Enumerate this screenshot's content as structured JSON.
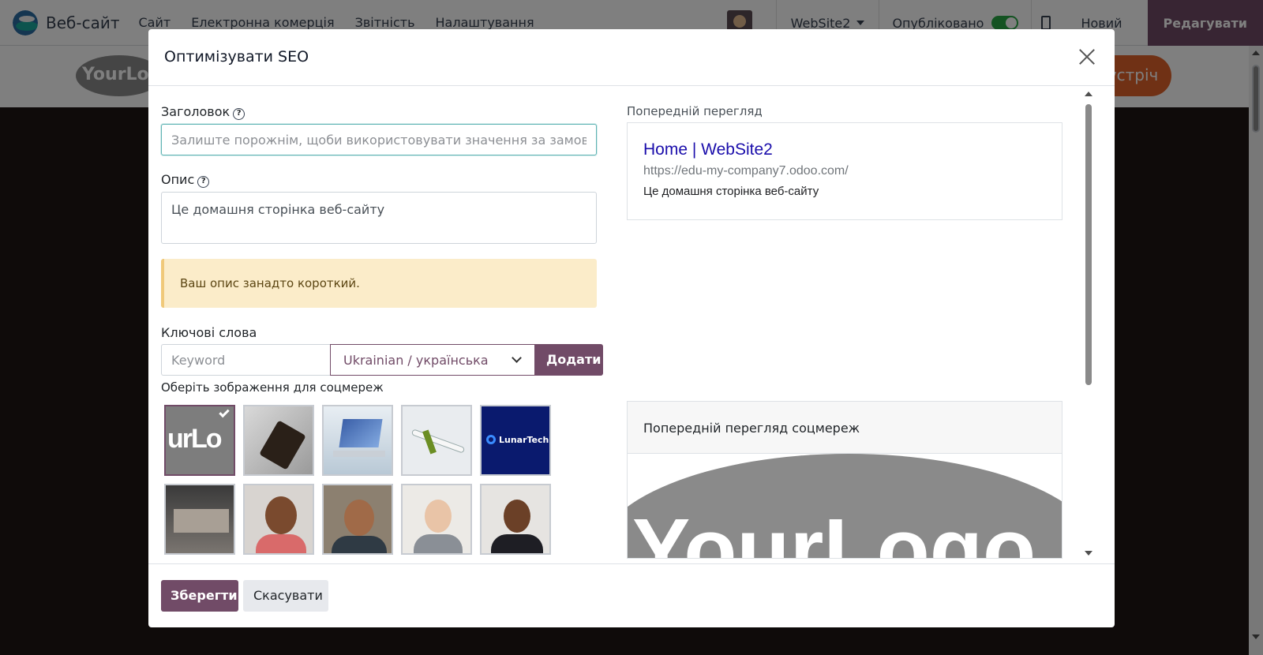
{
  "navbar": {
    "app_title": "Веб-сайт",
    "menu": [
      "Сайт",
      "Електронна комерція",
      "Звітність",
      "Налаштування"
    ],
    "website_switcher": "WebSite2",
    "published_label": "Опубліковано",
    "new_label": "Новий",
    "edit_label": "Редагувати"
  },
  "page": {
    "logo_text": "YourLogo",
    "cta_text": "Зустріч"
  },
  "modal": {
    "title": "Оптимізувати SEO",
    "title_field": {
      "label": "Заголовок",
      "value": "",
      "placeholder": "Залиште порожнім, щоби використовувати значення за замовчуванням"
    },
    "description_field": {
      "label": "Опис",
      "value": "Це домашня сторінка веб-сайту"
    },
    "warning": "Ваш опис занадто короткий.",
    "keywords": {
      "label": "Ключові слова",
      "placeholder": "Keyword",
      "language": "Ukrainian / українська",
      "add_label": "Додати"
    },
    "social_images": {
      "label": "Оберіть зображення для соцмереж",
      "items": [
        {
          "name": "Your Logo",
          "text": "urLo"
        },
        {
          "name": "Phone",
          "text": ""
        },
        {
          "name": "Laptop",
          "text": ""
        },
        {
          "name": "Airplane",
          "text": ""
        },
        {
          "name": "LunarTech",
          "text": "LunarTech"
        },
        {
          "name": "Office",
          "text": ""
        },
        {
          "name": "Man with glasses",
          "text": ""
        },
        {
          "name": "Smiling man",
          "text": ""
        },
        {
          "name": "Woman",
          "text": ""
        },
        {
          "name": "Businesswoman",
          "text": ""
        }
      ]
    },
    "preview": {
      "label": "Попередній перегляд",
      "title": "Home | WebSite2",
      "url": "https://edu-my-company7.odoo.com/",
      "description": "Це домашня сторінка веб-сайту"
    },
    "social_preview": {
      "label": "Попередній перегляд соцмереж",
      "image_text": "YourLogo"
    },
    "footer": {
      "save_label": "Зберегти",
      "cancel_label": "Скасувати"
    }
  },
  "colors": {
    "primary": "#714b67",
    "link": "#1a0dab",
    "warning_bg": "#fbecc9",
    "toggle_on": "#28a745"
  }
}
